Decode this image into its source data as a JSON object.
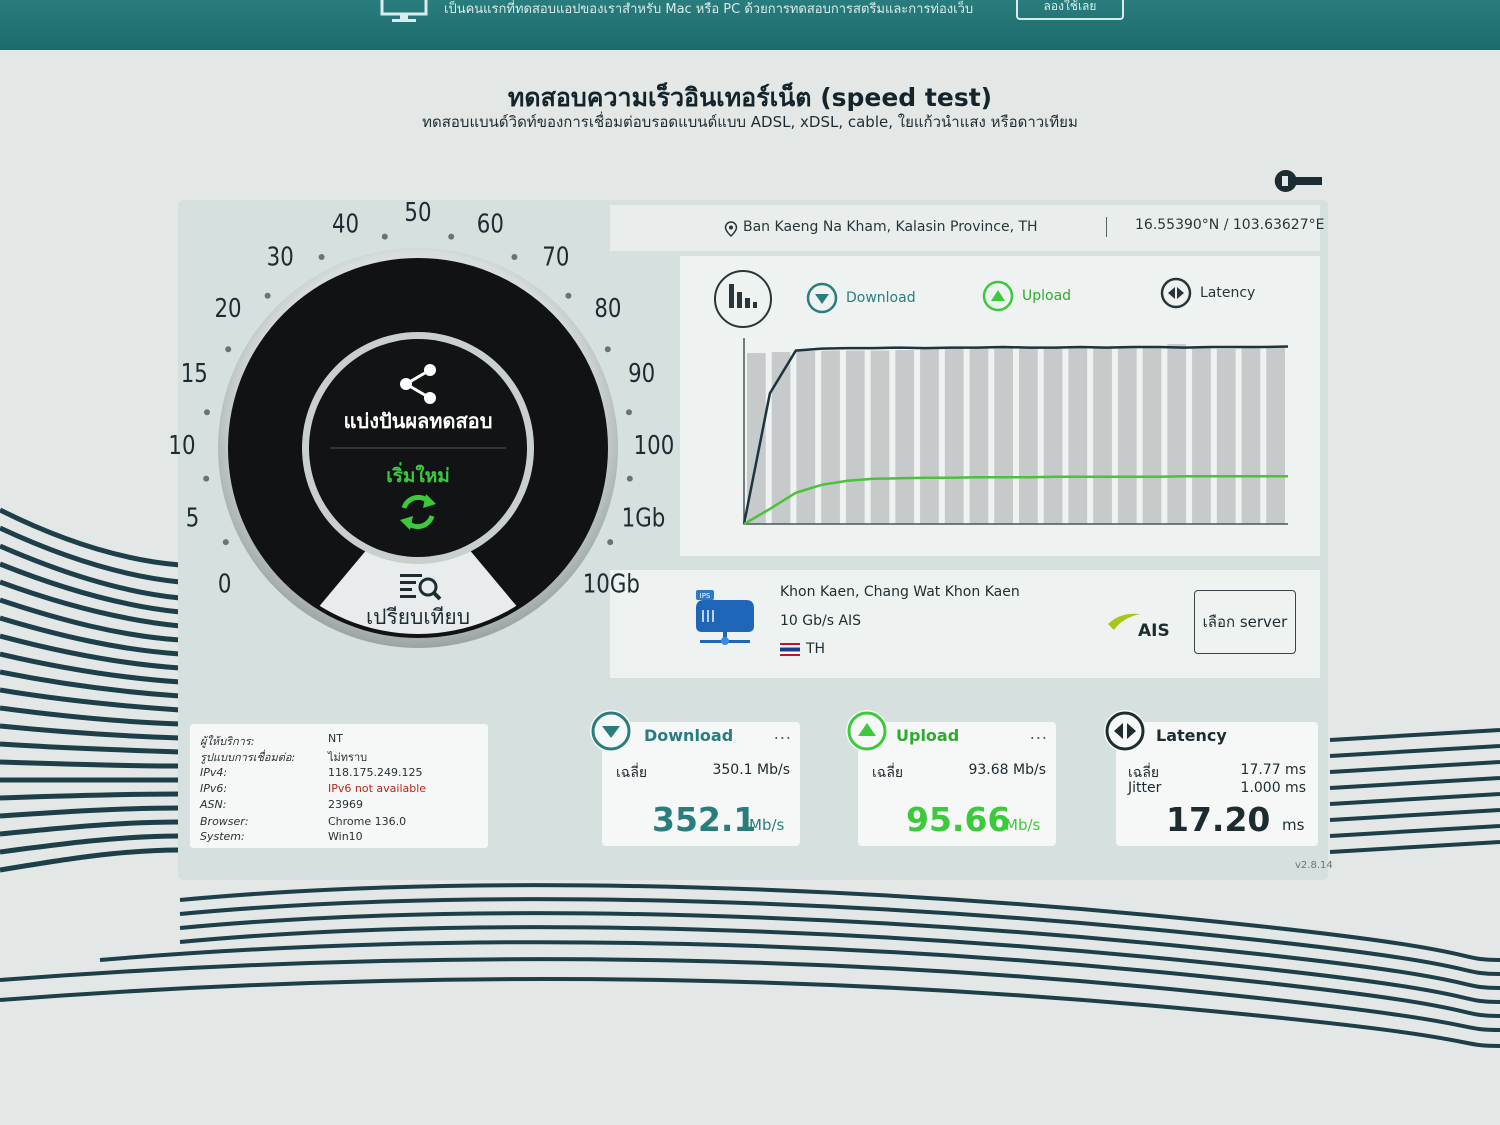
{
  "topbar": {
    "promo": "เป็นคนแรกที่ทดสอบแอปของเราสำหรับ Mac หรือ PC ด้วยการทดสอบการสตรีมและการท่องเว็บ",
    "try_button": "ลองใช้เลย"
  },
  "header": {
    "title": "ทดสอบความเร็วอินเทอร์เน็ต (speed test)",
    "subtitle": "ทดสอบแบนด์วิดท์ของการเชื่อมต่อบรอดแบนด์แบบ ADSL, xDSL, cable, ใยแก้วนำแสง หรือดาวเทียม"
  },
  "location": {
    "place": "Ban Kaeng Na Kham, Kalasin Province, TH",
    "coords": "16.55390°N / 103.63627°E"
  },
  "gauge": {
    "scale_labels": [
      "0",
      "5",
      "10",
      "15",
      "20",
      "30",
      "40",
      "50",
      "60",
      "70",
      "80",
      "90",
      "100",
      "1Gb",
      "10Gb"
    ],
    "share_label": "แบ่งปันผลทดสอบ",
    "restart_label": "เริ่มใหม่",
    "compare_label": "เปรียบเทียบ"
  },
  "legend": {
    "download": "Download",
    "upload": "Upload",
    "latency": "Latency"
  },
  "colors": {
    "download_line": "#1c3440",
    "upload_line": "#4cc13a",
    "accent_teal": "#2a7d7d",
    "accent_green": "#3cc93c",
    "bars": "#c6cacb"
  },
  "chart_data": {
    "type": "line",
    "series": [
      {
        "values": [
          0,
          260,
          345,
          349,
          350,
          350,
          351,
          350,
          351,
          351,
          352,
          351,
          351,
          352,
          351,
          352,
          352,
          351,
          352,
          352,
          352,
          353
        ]
      },
      {
        "values": [
          0,
          30,
          62,
          78,
          86,
          90,
          91,
          92,
          92,
          93,
          93,
          93,
          94,
          94,
          94,
          94,
          94,
          95,
          95,
          95,
          95,
          95
        ]
      }
    ],
    "bars": [
      340,
      342,
      344,
      345,
      345,
      345,
      346,
      352,
      352,
      350,
      352,
      352,
      349,
      351,
      351,
      352,
      352,
      358,
      353,
      348,
      350,
      354
    ],
    "ylim": [
      0,
      370
    ]
  },
  "server": {
    "city": "Khon Kaen, Chang Wat Khon Kaen",
    "provider": "10 Gb/s AIS",
    "country": "TH",
    "icon_badge": "IPS",
    "brand": "AIS",
    "select_label": "เลือก server"
  },
  "info": {
    "rows": [
      {
        "key": "ผู้ให้บริการ:",
        "value": "NT"
      },
      {
        "key": "รูปแบบการเชื่อมต่อ:",
        "value": "ไม่ทราบ"
      },
      {
        "key": "IPv4:",
        "value": "118.175.249.125"
      },
      {
        "key": "IPv6:",
        "value": "IPv6 not available"
      },
      {
        "key": "ASN:",
        "value": "23969"
      },
      {
        "key": "Browser:",
        "value": "Chrome 136.0"
      },
      {
        "key": "System:",
        "value": "Win10"
      }
    ]
  },
  "metrics": {
    "download": {
      "title": "Download",
      "dots": "...",
      "avg_label": "เฉลี่ย",
      "avg_value": "350.1 Mb/s",
      "value": "352.1",
      "unit": "Mb/s"
    },
    "upload": {
      "title": "Upload",
      "dots": "...",
      "avg_label": "เฉลี่ย",
      "avg_value": "93.68 Mb/s",
      "value": "95.66",
      "unit": "Mb/s"
    },
    "latency": {
      "title": "Latency",
      "avg_label": "เฉลี่ย",
      "avg_value": "17.77 ms",
      "jitter_label": "Jitter",
      "jitter_value": "1.000 ms",
      "value": "17.20",
      "unit": "ms"
    }
  },
  "version": "v2.8.14"
}
